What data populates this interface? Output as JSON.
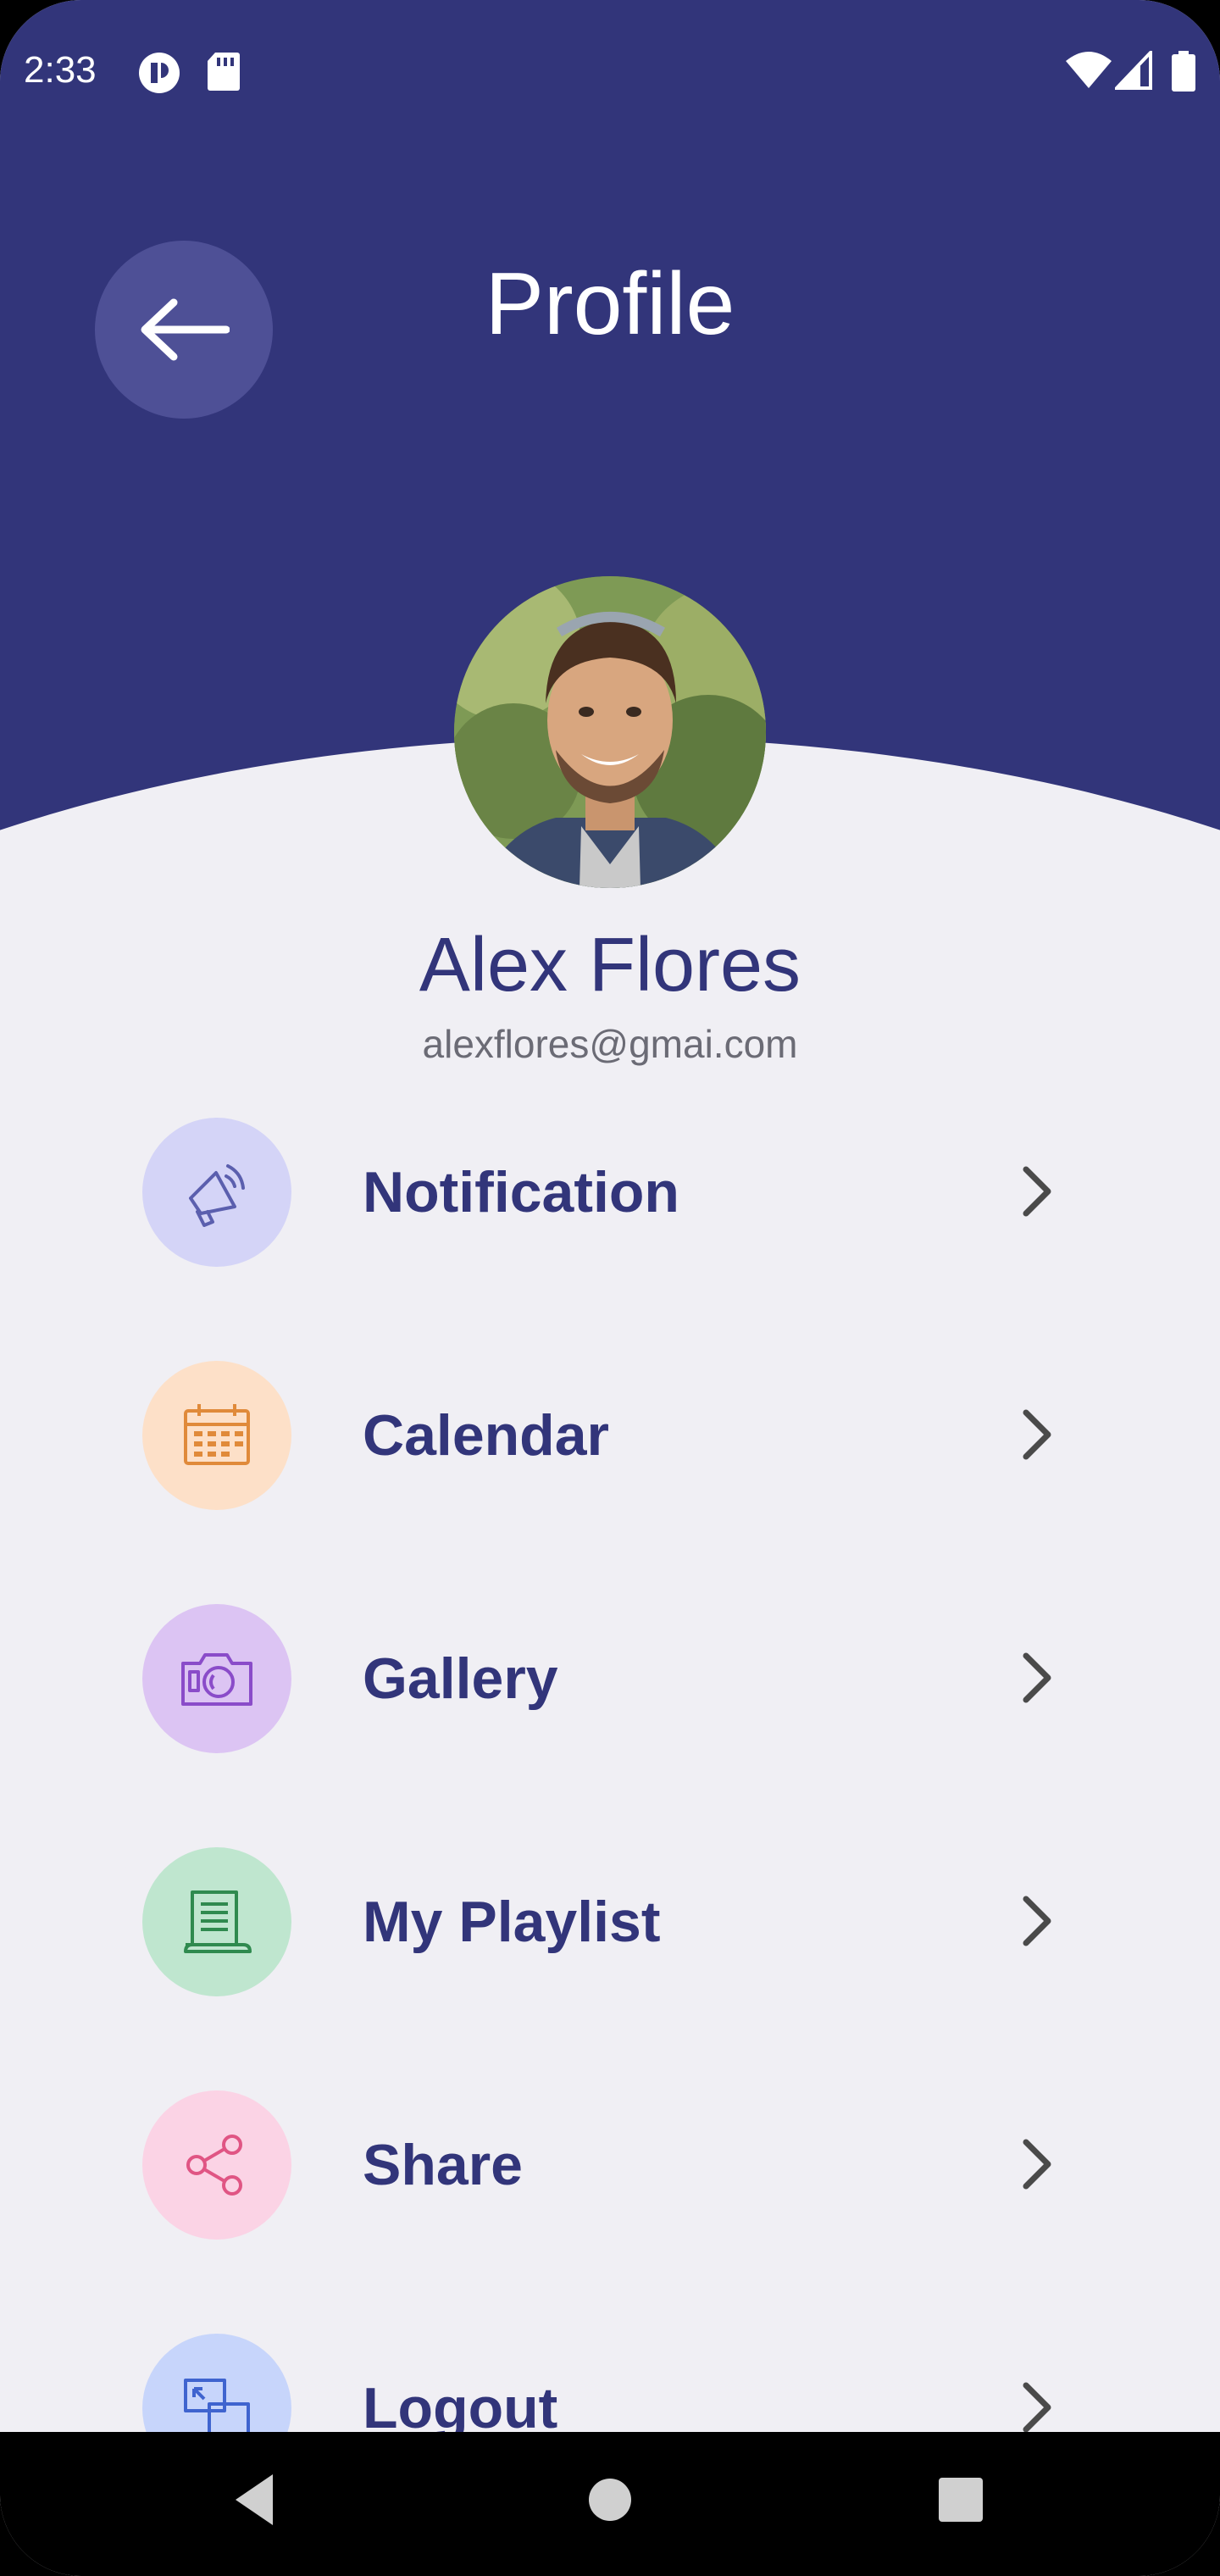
{
  "status_bar": {
    "time": "2:33"
  },
  "header": {
    "title": "Profile",
    "back_icon": "arrow-left-icon"
  },
  "profile": {
    "name": "Alex Flores",
    "email": "alexflores@gmai.com"
  },
  "menu": {
    "items": [
      {
        "label": "Notification",
        "icon": "megaphone-icon",
        "icon_bg": "#d4d4f7",
        "icon_color": "#5b5fae"
      },
      {
        "label": "Calendar",
        "icon": "calendar-icon",
        "icon_bg": "#fde0c8",
        "icon_color": "#e08a3a"
      },
      {
        "label": "Gallery",
        "icon": "camera-icon",
        "icon_bg": "#dcc4f3",
        "icon_color": "#8a4cc9"
      },
      {
        "label": "My Playlist",
        "icon": "playlist-icon",
        "icon_bg": "#bfe6cf",
        "icon_color": "#2f8a4f"
      },
      {
        "label": "Share",
        "icon": "share-icon",
        "icon_bg": "#fbd3e5",
        "icon_color": "#e05584"
      },
      {
        "label": "Logout",
        "icon": "logout-icon",
        "icon_bg": "#c7d5fb",
        "icon_color": "#3f64cf"
      }
    ]
  },
  "colors": {
    "primary": "#32357a",
    "background": "#f0eff4"
  }
}
